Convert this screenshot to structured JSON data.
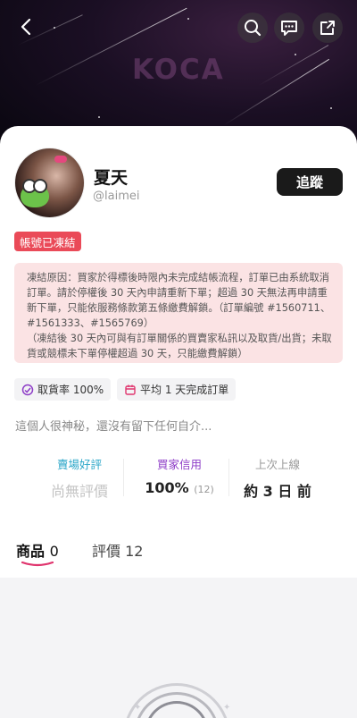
{
  "hero": {
    "logo_text": "KOCA"
  },
  "profile": {
    "name": "夏天",
    "handle": "@laimei",
    "follow_label": "追蹤"
  },
  "status": {
    "frozen_badge": "帳號已凍結",
    "notice_line1": "凍結原因：買家於得標後時限內未完成結帳流程，訂單已由系統取消訂單。請於停權後 30 天內申請重新下單；超過 30 天無法再申請重新下單，只能依服務條款第五條繳費解鎖。（訂單編號 #1560711、#1561333、#1565769）",
    "notice_line2": "（凍結後 30 天內可與有訂單關係的買賣家私訊以及取貨/出貨；未取貨或競標未下單停權超過 30 天，只能繳費解鎖）"
  },
  "chips": {
    "shipping_rate": "取貨率 100%",
    "avg_days": "平均 1 天完成訂單"
  },
  "bio": "這個人很神秘，還沒有留下任何自介...",
  "metrics": {
    "seller_rating_title": "賣場好評",
    "seller_rating_value": "尚無評價",
    "buyer_credit_title": "買家信用",
    "buyer_credit_value": "100%",
    "buyer_credit_count": "(12)",
    "last_online_title": "上次上線",
    "last_online_value": "約 3 日 前"
  },
  "tabs": {
    "products_label": "商品",
    "products_count": "0",
    "reviews_label": "評價",
    "reviews_count": "12"
  },
  "colors": {
    "seller_title": "#2aa6c8",
    "buyer_title": "#8d3cc7",
    "last_title": "#999999",
    "badge_red": "#ea4a58",
    "notice_bg": "#fbe3e4",
    "tab_underline": "#e0356e"
  },
  "icons": {
    "back": "chevron-left-icon",
    "search": "search-icon",
    "message": "chat-bubble-icon",
    "share": "share-icon",
    "shipping": "delivery-icon",
    "calendar": "calendar-icon"
  }
}
